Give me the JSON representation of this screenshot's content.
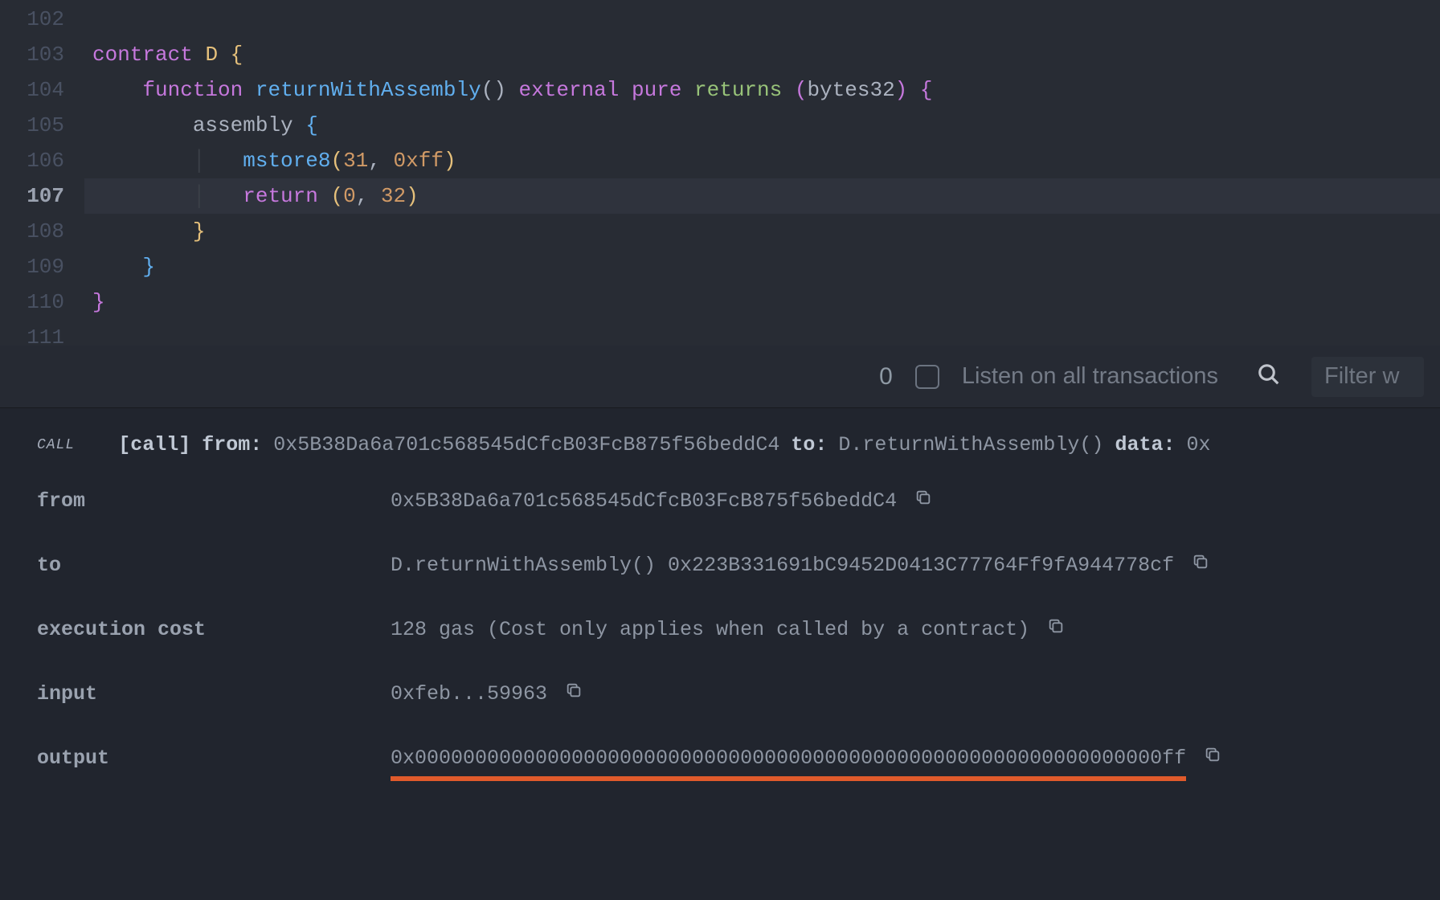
{
  "editor": {
    "active_line": 107,
    "lines": [
      {
        "num": 102,
        "tokens": []
      },
      {
        "num": 103,
        "tokens": [
          {
            "t": "contract",
            "c": "tok-kw"
          },
          {
            "t": " ",
            "c": ""
          },
          {
            "t": "D",
            "c": "tok-name"
          },
          {
            "t": " ",
            "c": ""
          },
          {
            "t": "{",
            "c": "tok-brace-y"
          }
        ]
      },
      {
        "num": 104,
        "tokens": [
          {
            "t": "    ",
            "c": ""
          },
          {
            "t": "function",
            "c": "tok-kw"
          },
          {
            "t": " ",
            "c": ""
          },
          {
            "t": "returnWithAssembly",
            "c": "tok-fn"
          },
          {
            "t": "()",
            "c": "tok-punct"
          },
          {
            "t": " ",
            "c": ""
          },
          {
            "t": "external",
            "c": "tok-kw"
          },
          {
            "t": " ",
            "c": ""
          },
          {
            "t": "pure",
            "c": "tok-kw"
          },
          {
            "t": " ",
            "c": ""
          },
          {
            "t": "returns",
            "c": "tok-type"
          },
          {
            "t": " ",
            "c": ""
          },
          {
            "t": "(",
            "c": "tok-paren-m"
          },
          {
            "t": "bytes32",
            "c": "tok-punct"
          },
          {
            "t": ")",
            "c": "tok-paren-m"
          },
          {
            "t": " ",
            "c": ""
          },
          {
            "t": "{",
            "c": "tok-brace-p"
          }
        ]
      },
      {
        "num": 105,
        "tokens": [
          {
            "t": "        ",
            "c": ""
          },
          {
            "t": "assembly",
            "c": "tok-punct"
          },
          {
            "t": " ",
            "c": ""
          },
          {
            "t": "{",
            "c": "tok-brace-b"
          }
        ]
      },
      {
        "num": 106,
        "tokens": [
          {
            "t": "        ",
            "c": ""
          },
          {
            "t": "│   ",
            "c": "indent-guide"
          },
          {
            "t": "mstore8",
            "c": "tok-fn"
          },
          {
            "t": "(",
            "c": "tok-brace-y"
          },
          {
            "t": "31",
            "c": "tok-num"
          },
          {
            "t": ", ",
            "c": "tok-punct"
          },
          {
            "t": "0xff",
            "c": "tok-num"
          },
          {
            "t": ")",
            "c": "tok-brace-y"
          }
        ]
      },
      {
        "num": 107,
        "highlighted": true,
        "tokens": [
          {
            "t": "        ",
            "c": ""
          },
          {
            "t": "│   ",
            "c": "indent-guide"
          },
          {
            "t": "return",
            "c": "tok-kw"
          },
          {
            "t": " ",
            "c": ""
          },
          {
            "t": "(",
            "c": "tok-brace-y"
          },
          {
            "t": "0",
            "c": "tok-num"
          },
          {
            "t": ", ",
            "c": "tok-punct"
          },
          {
            "t": "32",
            "c": "tok-num"
          },
          {
            "t": ")",
            "c": "tok-brace-y"
          }
        ]
      },
      {
        "num": 108,
        "tokens": [
          {
            "t": "        ",
            "c": ""
          },
          {
            "t": "}",
            "c": "tok-brace-y"
          }
        ]
      },
      {
        "num": 109,
        "tokens": [
          {
            "t": "    ",
            "c": ""
          },
          {
            "t": "}",
            "c": "tok-brace-b"
          }
        ]
      },
      {
        "num": 110,
        "tokens": [
          {
            "t": "}",
            "c": "tok-brace-p"
          }
        ]
      },
      {
        "num": 111,
        "tokens": []
      }
    ]
  },
  "toolbar": {
    "count": "0",
    "listen_label": "Listen on all transactions",
    "filter_placeholder": "Filter w"
  },
  "transaction": {
    "badge": "CALL",
    "summary": {
      "tag": "[call]",
      "from_label": "from:",
      "from": "0x5B38Da6a701c568545dCfcB03FcB875f56beddC4",
      "to_label": "to:",
      "to": "D.returnWithAssembly()",
      "data_label": "data:",
      "data": "0x"
    },
    "details": {
      "from_key": "from",
      "from_val": "0x5B38Da6a701c568545dCfcB03FcB875f56beddC4",
      "to_key": "to",
      "to_val": "D.returnWithAssembly() 0x223B331691bC9452D0413C77764Ff9fA944778cf",
      "cost_key": "execution cost",
      "cost_val": "128 gas (Cost only applies when called by a contract)",
      "input_key": "input",
      "input_val": "0xfeb...59963",
      "output_key": "output",
      "output_val": "0x00000000000000000000000000000000000000000000000000000000000000ff"
    }
  }
}
